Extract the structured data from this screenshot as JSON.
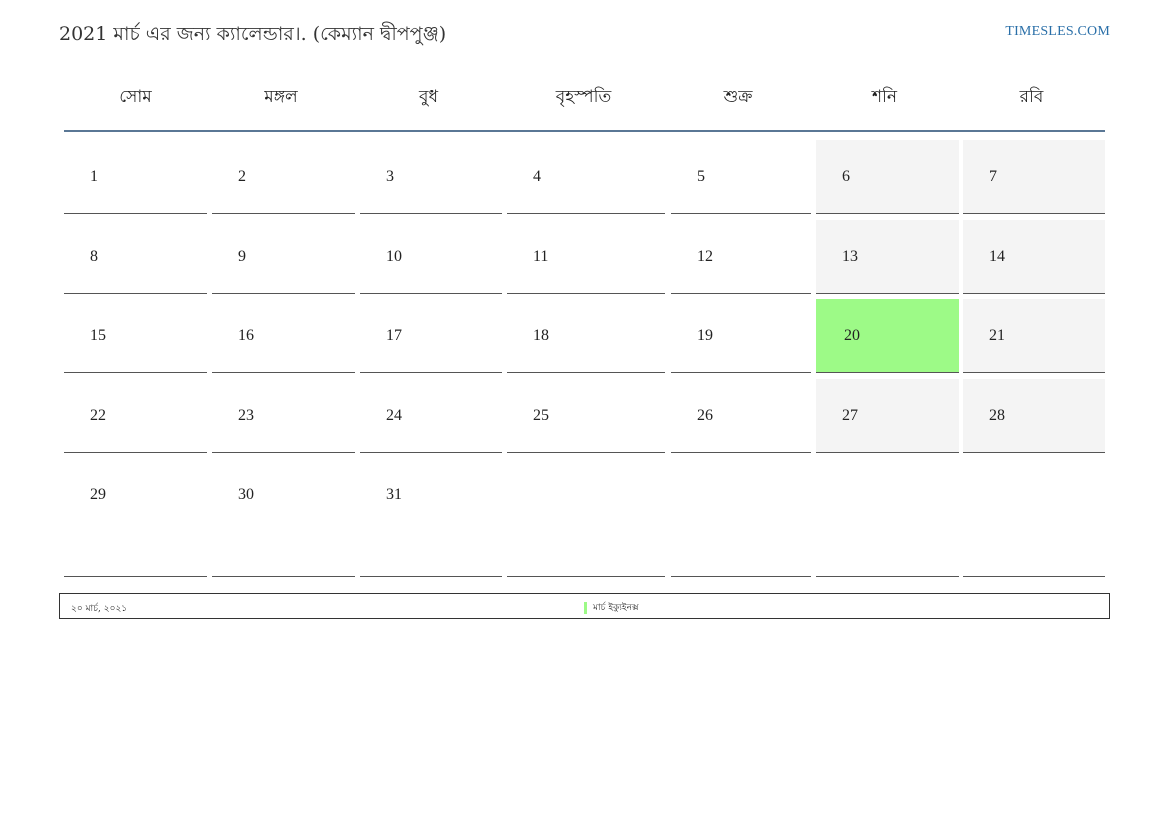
{
  "header": {
    "title": "2021 মার্চ এর জন্য ক্যালেন্ডার।. (কেম্যান দ্বীপপুঞ্জ)",
    "site": "TIMESLES.COM"
  },
  "calendar": {
    "weekdays": [
      "সোম",
      "মঙ্গল",
      "বুধ",
      "বৃহস্পতি",
      "শুক্র",
      "শনি",
      "রবি"
    ],
    "weeks": [
      [
        "1",
        "2",
        "3",
        "4",
        "5",
        "6",
        "7"
      ],
      [
        "8",
        "9",
        "10",
        "11",
        "12",
        "13",
        "14"
      ],
      [
        "15",
        "16",
        "17",
        "18",
        "19",
        "20",
        "21"
      ],
      [
        "22",
        "23",
        "24",
        "25",
        "26",
        "27",
        "28"
      ],
      [
        "29",
        "30",
        "31",
        "",
        "",
        "",
        ""
      ]
    ],
    "highlighted_day": "20"
  },
  "footer": {
    "date": "২০ মার্চ, ২০২১",
    "legend": "মার্চ ইক্যুইনক্স"
  },
  "colors": {
    "highlight": "#9dfa87",
    "weekend": "#f4f4f4",
    "header_rule": "#5a7795",
    "link": "#2a6fa8"
  }
}
